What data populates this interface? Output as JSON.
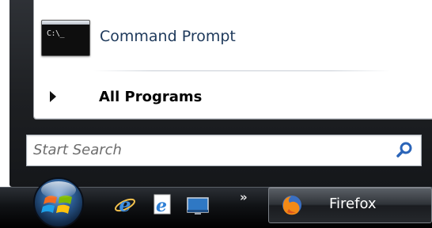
{
  "start_menu": {
    "programs": [
      {
        "label": "Command Prompt",
        "icon": "command-prompt-icon",
        "icon_text": "C:\\_"
      }
    ],
    "all_programs_label": "All Programs",
    "search": {
      "placeholder": "Start Search",
      "value": "",
      "icon": "search-icon"
    }
  },
  "taskbar": {
    "start_button": {
      "icon": "windows-orb-icon"
    },
    "quick_launch": [
      {
        "icon": "internet-explorer-icon"
      },
      {
        "icon": "internet-explorer-icon"
      },
      {
        "icon": "show-desktop-icon"
      }
    ],
    "overflow_label": "»",
    "tasks": [
      {
        "label": "Firefox",
        "icon": "firefox-icon"
      }
    ]
  },
  "colors": {
    "menu_frame": "#1d1f22",
    "program_text": "#1e395b",
    "search_icon": "#2a64b8",
    "taskbar": "#101215"
  }
}
